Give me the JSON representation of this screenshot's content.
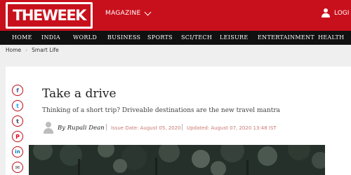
{
  "header": {
    "logo_text": "THEWEEK",
    "magazine_label": "MAGAZINE",
    "login_label": "LOGI"
  },
  "nav": {
    "items": [
      "HOME",
      "INDIA",
      "WORLD",
      "BUSINESS",
      "SPORTS",
      "SCI/TECH",
      "LEISURE",
      "ENTERTAINMENT",
      "HEALTH"
    ]
  },
  "breadcrumb": {
    "home": "Home",
    "section": "Smart Life",
    "separator": "›"
  },
  "share": {
    "icons": [
      "facebook-icon",
      "twitter-icon",
      "tumblr-icon",
      "pinterest-icon",
      "linkedin-icon",
      "email-icon"
    ],
    "glyphs": [
      "f",
      "t",
      "t",
      "P",
      "in",
      "✉"
    ]
  },
  "article": {
    "title": "Take a drive",
    "subtitle": "Thinking of a short trip? Driveable destinations are the new travel mantra",
    "byline": "By Rupali Dean",
    "issue_date": "Issue Date: August 05, 2020",
    "updated": "Updated: August 07, 2020 13:48 IST",
    "pipe": "|"
  },
  "colors": {
    "brand_red": "#c8101c",
    "nav_black": "#111111",
    "meta_color": "#c87a72"
  }
}
